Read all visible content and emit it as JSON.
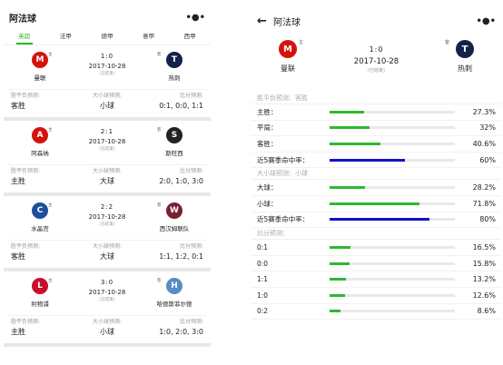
{
  "colors": {
    "accent": "#2db52d",
    "green_bar": "#2fb92f",
    "blue_bar": "#1212c8",
    "divider": "#e8e8e8"
  },
  "left": {
    "title": "阿法球",
    "menu_icon": "more-dots-icon",
    "tabs": [
      {
        "label": "英超",
        "active": true
      },
      {
        "label": "法甲",
        "active": false
      },
      {
        "label": "德甲",
        "active": false
      },
      {
        "label": "意甲",
        "active": false
      },
      {
        "label": "西甲",
        "active": false
      }
    ],
    "pred_labels": [
      "胜平负预测:",
      "大小球预测:",
      "比分预测:"
    ],
    "matches": [
      {
        "home": "曼联",
        "home_tag": "主",
        "home_color": "#d4140c",
        "home_glyph": "M",
        "away": "热刺",
        "away_tag": "客",
        "away_color": "#13224a",
        "away_glyph": "T",
        "score": "1:0",
        "date": "2017-10-28",
        "status": "(已结束)",
        "pred_wdl": "客胜",
        "pred_ou": "小球",
        "pred_score": "0:1, 0:0, 1:1"
      },
      {
        "home": "阿森纳",
        "home_tag": "主",
        "home_color": "#d4140c",
        "home_glyph": "A",
        "away": "斯旺西",
        "away_tag": "客",
        "away_color": "#222222",
        "away_glyph": "S",
        "score": "2:1",
        "date": "2017-10-28",
        "status": "(已结束)",
        "pred_wdl": "主胜",
        "pred_ou": "大球",
        "pred_score": "2:0, 1:0, 3:0"
      },
      {
        "home": "水晶宫",
        "home_tag": "主",
        "home_color": "#1b4e9b",
        "home_glyph": "C",
        "away": "西汉姆联队",
        "away_tag": "客",
        "away_color": "#7a2033",
        "away_glyph": "W",
        "score": "2:2",
        "date": "2017-10-28",
        "status": "(已结束)",
        "pred_wdl": "客胜",
        "pred_ou": "大球",
        "pred_score": "1:1, 1:2, 0:1"
      },
      {
        "home": "利物浦",
        "home_tag": "主",
        "home_color": "#c8102e",
        "home_glyph": "L",
        "away": "哈德斯菲尔德",
        "away_tag": "客",
        "away_color": "#5b8ac6",
        "away_glyph": "H",
        "score": "3:0",
        "date": "2017-10-28",
        "status": "(已结束)",
        "pred_wdl": "主胜",
        "pred_ou": "小球",
        "pred_score": "1:0, 2:0, 3:0"
      }
    ]
  },
  "right": {
    "back_icon": "arrow-left-icon",
    "title": "阿法球",
    "menu_icon": "more-dots-icon",
    "match": {
      "home": "曼联",
      "home_tag": "主",
      "home_color": "#d4140c",
      "home_glyph": "M",
      "away": "热刺",
      "away_tag": "客",
      "away_color": "#13224a",
      "away_glyph": "T",
      "score": "1:0",
      "date": "2017-10-28",
      "status": "(已结束)"
    },
    "sections": [
      {
        "header": "胜平负预测：客胜",
        "rows": [
          {
            "label": "主胜：",
            "value": "27.3%",
            "fraction": 0.273,
            "bar": "green"
          },
          {
            "label": "平局：",
            "value": "32%",
            "fraction": 0.32,
            "bar": "green"
          },
          {
            "label": "客胜：",
            "value": "40.6%",
            "fraction": 0.406,
            "bar": "green"
          },
          {
            "label": "近5赛季命中率：",
            "value": "60%",
            "fraction": 0.6,
            "bar": "blue"
          }
        ]
      },
      {
        "header": "大小球预测：小球",
        "rows": [
          {
            "label": "大球：",
            "value": "28.2%",
            "fraction": 0.282,
            "bar": "green"
          },
          {
            "label": "小球：",
            "value": "71.8%",
            "fraction": 0.718,
            "bar": "green"
          },
          {
            "label": "近5赛季命中率：",
            "value": "80%",
            "fraction": 0.8,
            "bar": "blue"
          }
        ]
      },
      {
        "header": "比分预测：",
        "rows": [
          {
            "label": "0:1",
            "value": "16.5%",
            "fraction": 0.165,
            "bar": "green"
          },
          {
            "label": "0:0",
            "value": "15.8%",
            "fraction": 0.158,
            "bar": "green"
          },
          {
            "label": "1:1",
            "value": "13.2%",
            "fraction": 0.132,
            "bar": "green"
          },
          {
            "label": "1:0",
            "value": "12.6%",
            "fraction": 0.126,
            "bar": "green"
          },
          {
            "label": "0:2",
            "value": "8.6%",
            "fraction": 0.086,
            "bar": "green"
          }
        ]
      }
    ]
  }
}
